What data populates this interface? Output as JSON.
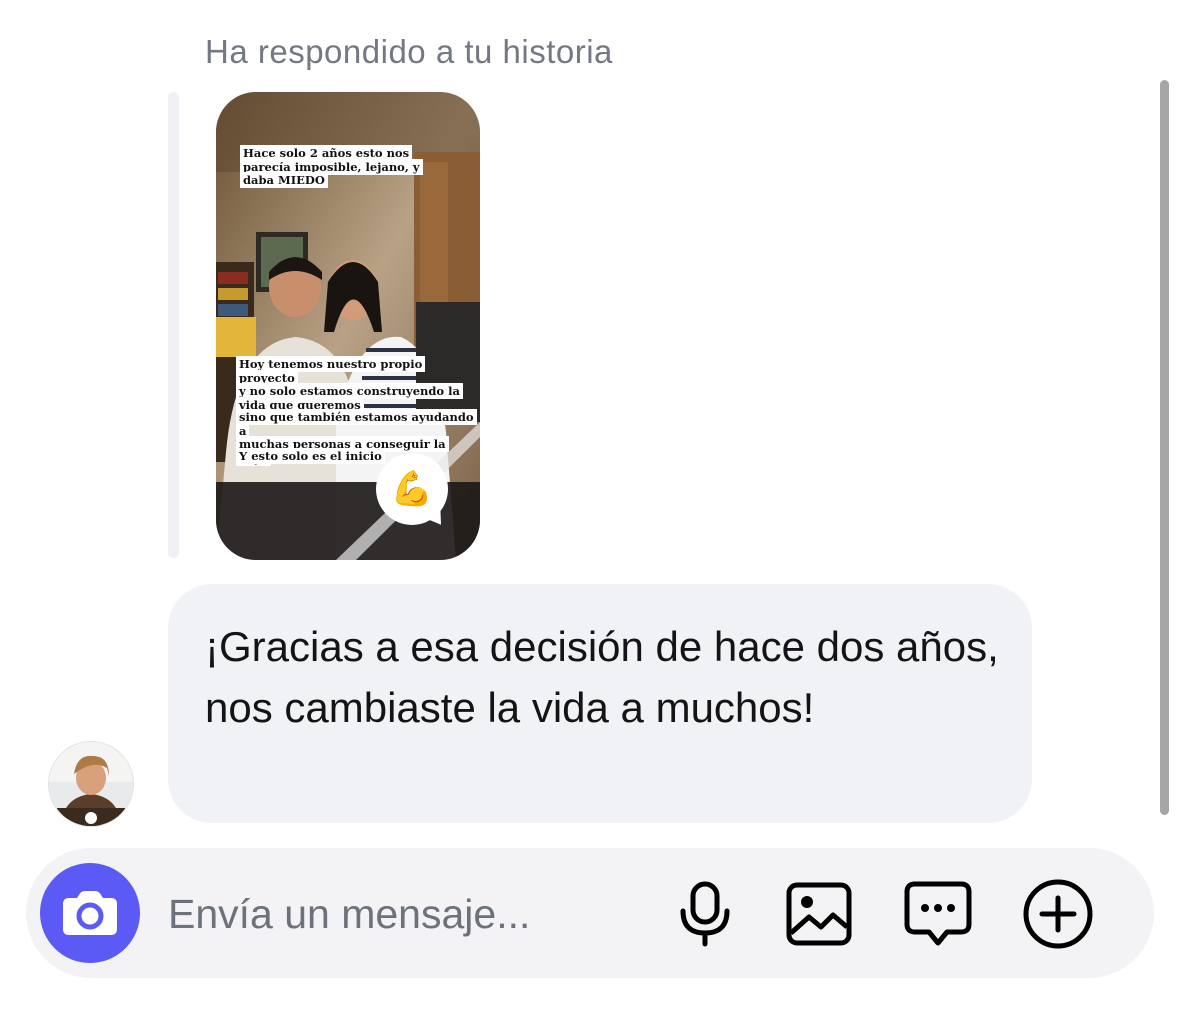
{
  "reply_context": {
    "label": "Ha respondido a tu historia"
  },
  "story": {
    "captions": [
      "Hace solo 2 años esto nos\nparecía imposible, lejano, y\ndaba MIEDO",
      "Hoy tenemos nuestro propio proyecto\ny no solo estamos construyendo la\nvida que queremos",
      "sino que también estamos ayudando a\nmuchas personas a conseguir la suya",
      "Y esto solo es el inicio"
    ],
    "sticker_icon": "flexed-biceps-emoji",
    "sticker_glyph": "💪"
  },
  "message": {
    "text": "¡Gracias a esa decisión de hace dos años, nos cambiaste la vida a muchos!"
  },
  "composer": {
    "placeholder": "Envía un mensaje...",
    "camera_icon": "camera-icon",
    "mic_icon": "microphone-icon",
    "gallery_icon": "image-icon",
    "sticker_icon": "chat-bubble-dots-icon",
    "plus_icon": "plus-circle-icon"
  },
  "colors": {
    "accent": "#5b5af5",
    "bubble": "#f1f2f5",
    "composer_bg": "#f3f3f5",
    "muted_text": "#737882"
  }
}
